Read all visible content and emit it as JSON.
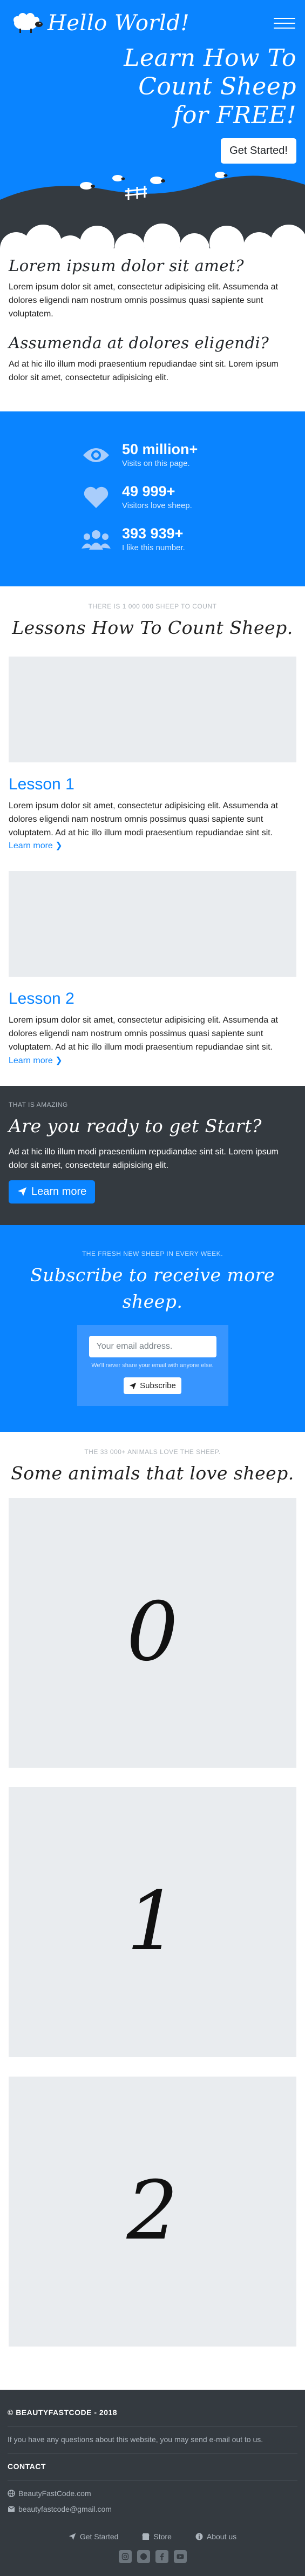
{
  "navbar": {
    "brand": "Hello World!",
    "toggle_icon": "hamburger-menu-icon"
  },
  "hero": {
    "title": "Learn How To Count Sheep for FREE!",
    "cta_label": "Get Started!",
    "colors": {
      "primary": "#0a84ff",
      "hills": "#343a40"
    }
  },
  "intro": {
    "heading1": "Lorem ipsum dolor sit amet?",
    "para1": "Lorem ipsum dolor sit amet, consectetur adipisicing elit. Assumenda at dolores eligendi nam nostrum omnis possimus quasi sapiente sunt voluptatem.",
    "heading2": "Assumenda at dolores eligendi?",
    "para2": "Ad at hic illo illum modi praesentium repudiandae sint sit. Lorem ipsum dolor sit amet, consectetur adipisicing elit."
  },
  "stats": [
    {
      "icon": "eye-icon",
      "value": "50 million+",
      "label": "Visits on this page."
    },
    {
      "icon": "heart-icon",
      "value": "49 999+",
      "label": "Visitors love sheep."
    },
    {
      "icon": "users-icon",
      "value": "393 939+",
      "label": "I like this number."
    }
  ],
  "lessons_section": {
    "kicker": "THERE IS 1 000 000 SHEEP TO COUNT",
    "title": "Lessons How To Count Sheep.",
    "items": [
      {
        "title": "Lesson 1",
        "text": "Lorem ipsum dolor sit amet, consectetur adipisicing elit. Assumenda at dolores eligendi nam nostrum omnis possimus quasi sapiente sunt voluptatem. Ad at hic illo illum modi praesentium repudiandae sint sit.",
        "link": "Learn more"
      },
      {
        "title": "Lesson 2",
        "text": "Lorem ipsum dolor sit amet, consectetur adipisicing elit. Assumenda at dolores eligendi nam nostrum omnis possimus quasi sapiente sunt voluptatem. Ad at hic illo illum modi praesentium repudiandae sint sit.",
        "link": "Learn more"
      }
    ]
  },
  "ready": {
    "kicker": "THAT IS AMAZING",
    "title": "Are you ready to get Start?",
    "text": "Ad at hic illo illum modi praesentium repudiandae sint sit. Lorem ipsum dolor sit amet, consectetur adipisicing elit.",
    "button": "Learn more"
  },
  "subscribe": {
    "kicker": "THE FRESH NEW SHEEP IN EVERY WEEK.",
    "title": "Subscribe to receive more sheep.",
    "placeholder": "Your email address.",
    "help": "We'll never share your email with anyone else.",
    "button": "Subscribe"
  },
  "animals": {
    "kicker": "THE 33 000+ ANIMALS LOVE THE SHEEP.",
    "title": "Some animals that love sheep.",
    "cards": [
      "0",
      "1",
      "2"
    ]
  },
  "footer": {
    "copyright": "© BEAUTYFASTCODE - 2018",
    "about": "If you have any questions about this website, you may send e-mail out to us.",
    "contact_title": "CONTACT",
    "contacts": [
      {
        "icon": "globe-icon",
        "text": "BeautyFastCode.com"
      },
      {
        "icon": "envelope-icon",
        "text": "beautyfastcode@gmail.com"
      }
    ],
    "nav": [
      {
        "icon": "paper-plane-icon",
        "label": "Get Started"
      },
      {
        "icon": "shop-icon",
        "label": "Store"
      },
      {
        "icon": "info-icon",
        "label": "About us"
      }
    ],
    "socials": [
      "instagram-icon",
      "github-icon",
      "facebook-icon",
      "youtube-icon"
    ]
  }
}
